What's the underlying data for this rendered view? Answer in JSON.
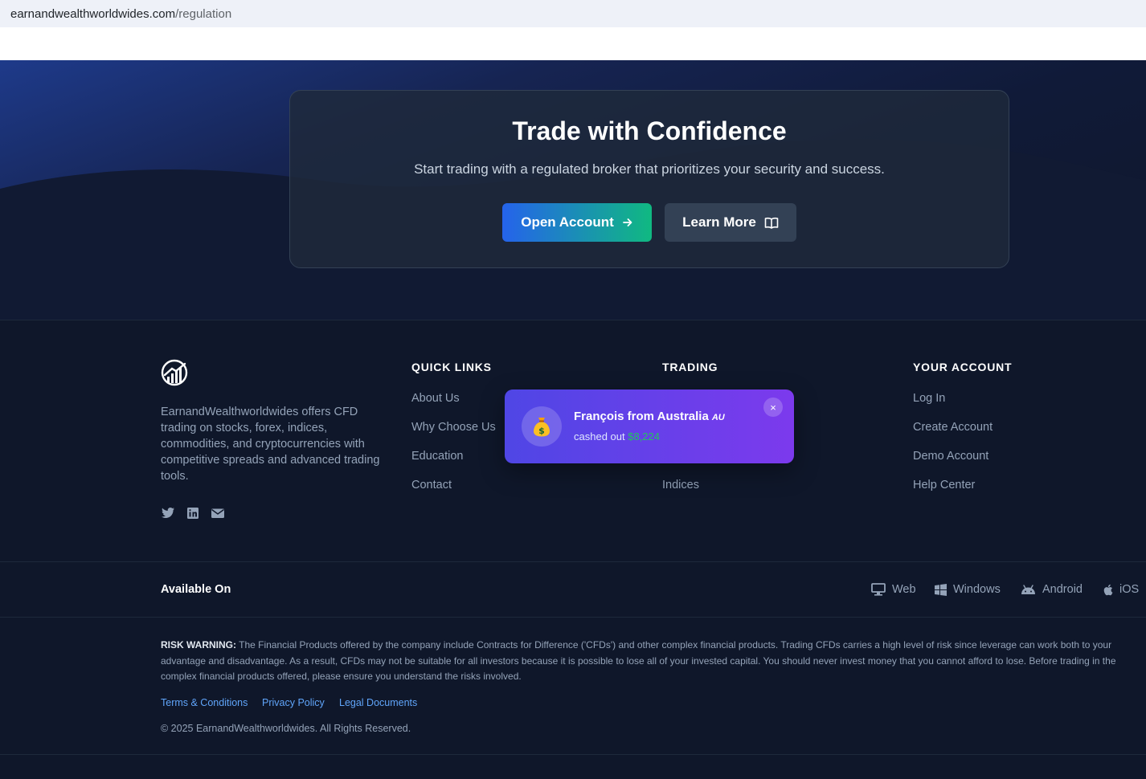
{
  "browser": {
    "url_host": "earnandwealthworldwides.com",
    "url_path": "/regulation"
  },
  "cta": {
    "title": "Trade with Confidence",
    "subtitle": "Start trading with a regulated broker that prioritizes your security and success.",
    "open_account_label": "Open Account",
    "learn_more_label": "Learn More"
  },
  "footer": {
    "logo_icon": "chart-logo-icon",
    "description": "EarnandWealthworldwides offers CFD trading on stocks, forex, indices, commodities, and cryptocurrencies with competitive spreads and advanced trading tools.",
    "social": [
      "twitter-icon",
      "linkedin-icon",
      "envelope-icon"
    ],
    "columns": [
      {
        "heading": "QUICK LINKS",
        "links": [
          "About Us",
          "Why Choose Us",
          "Education",
          "Contact"
        ]
      },
      {
        "heading": "TRADING",
        "links": [
          "Indices"
        ]
      },
      {
        "heading": "YOUR ACCOUNT",
        "links": [
          "Log In",
          "Create Account",
          "Demo Account",
          "Help Center"
        ]
      }
    ]
  },
  "toast": {
    "name": "François from Australia",
    "country_code": "AU",
    "action": "cashed out",
    "amount": "$8,224",
    "icon": "money-bag-icon",
    "close_symbol": "×"
  },
  "available": {
    "label": "Available On",
    "platforms": [
      {
        "name": "Web",
        "icon": "desktop-icon"
      },
      {
        "name": "Windows",
        "icon": "windows-icon"
      },
      {
        "name": "Android",
        "icon": "android-icon"
      },
      {
        "name": "iOS",
        "icon": "apple-icon"
      }
    ]
  },
  "legal": {
    "risk_label": "RISK WARNING:",
    "risk_text": " The Financial Products offered by the company include Contracts for Difference ('CFDs') and other complex financial products. Trading CFDs carries a high level of risk since leverage can work both to your advantage and disadvantage. As a result, CFDs may not be suitable for all investors because it is possible to lose all of your invested capital. You should never invest money that you cannot afford to lose. Before trading in the complex financial products offered, please ensure you understand the risks involved.",
    "links": [
      "Terms & Conditions",
      "Privacy Policy",
      "Legal Documents"
    ],
    "copyright": "© 2025 EarnandWealthworldwides. All Rights Reserved."
  },
  "colors": {
    "page_bg": "#0f172a",
    "accent_blue": "#2563eb",
    "accent_green": "#10b981",
    "toast_purple": "#7c3aed",
    "link_blue": "#60a5fa"
  }
}
